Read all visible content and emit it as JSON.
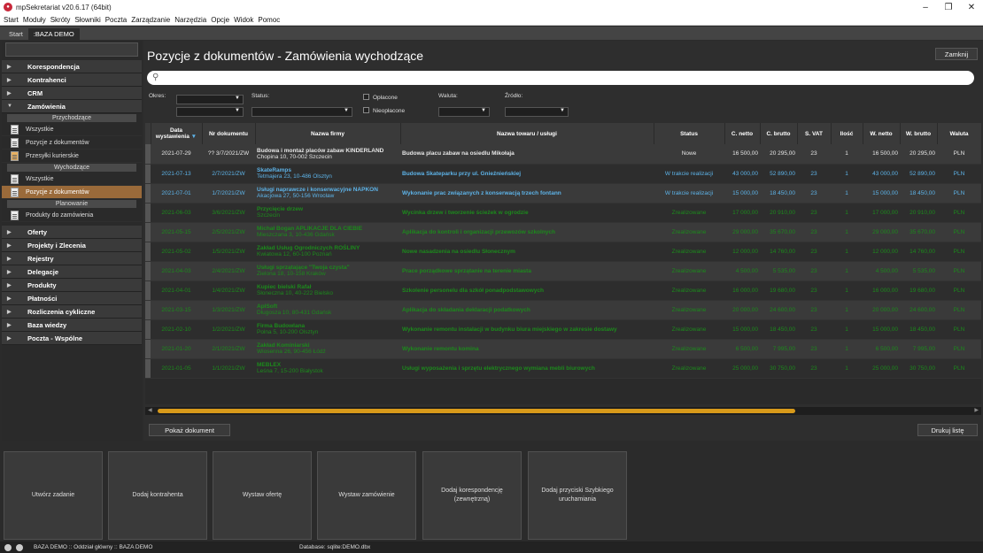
{
  "window": {
    "title": "mpSekretariat v20.6.17 (64bit)",
    "min": "–",
    "max": "❐",
    "close": "✕"
  },
  "menu": [
    "Start",
    "Moduły",
    "Skróty",
    "Słowniki",
    "Poczta",
    "Zarządzanie",
    "Narzędzia",
    "Opcje",
    "Widok",
    "Pomoc"
  ],
  "tabs": [
    {
      "label": "Start"
    },
    {
      "label": ":BAZA DEMO"
    }
  ],
  "sidebar": {
    "groups_top": [
      {
        "label": "Korespondencja"
      },
      {
        "label": "Kontrahenci"
      },
      {
        "label": "CRM"
      },
      {
        "label": "Zamówienia"
      }
    ],
    "sub_incoming": "Przychodzące",
    "incoming_items": [
      "Wszystkie",
      "Pozycje z dokumentów",
      "Przesyłki kurierskie"
    ],
    "sub_outgoing": "Wychodzące",
    "outgoing_items": [
      "Wszystkie",
      "Pozycje z dokumentów"
    ],
    "sub_planning": "Planowanie",
    "planning_items": [
      "Produkty do zamówienia"
    ],
    "groups_bottom": [
      "Oferty",
      "Projekty i Zlecenia",
      "Rejestry",
      "Delegacje",
      "Produkty",
      "Płatności",
      "Rozliczenia cykliczne",
      "Baza wiedzy",
      "Poczta - Wspólne"
    ]
  },
  "main": {
    "title": "Pozycje z dokumentów - Zamówienia wychodzące",
    "close_label": "Zamknij",
    "search_icon": "search-icon",
    "filters": {
      "okres": "Okres:",
      "status": "Status:",
      "paid": "Opłacone",
      "unpaid": "Nieopłacone",
      "currency": "Waluta:",
      "source": "Źródło:"
    },
    "columns": [
      "Data wystawienia",
      "Nr dokumentu",
      "Nazwa firmy",
      "Nazwa towaru / usługi",
      "Status",
      "C. netto",
      "C. brutto",
      "S. VAT",
      "Ilość",
      "W. netto",
      "W. brutto",
      "Waluta"
    ],
    "rows": [
      {
        "date": "2021-07-29",
        "doc": "?? 3/7/2021/ZW",
        "company": "Budowa i montaż placów zabaw KINDERLAND",
        "address": "Chopina 10, 70-002 Szczecin",
        "product": "Budowa placu zabaw na osiedlu Mikołaja",
        "status": "Nowe",
        "cnetto": "16 500,00",
        "cbrutto": "20 295,00",
        "vat": "23",
        "qty": "1",
        "wnetto": "16 500,00",
        "wbrutto": "20 295,00",
        "cur": "PLN",
        "color": "white"
      },
      {
        "date": "2021-07-13",
        "doc": "2/7/2021/ZW",
        "company": "SkateRamps",
        "address": "Tetmajera 23, 10-486 Olsztyn",
        "product": "Budowa Skateparku przy ul. Gnieźnieńskiej",
        "status": "W trakcie realizacji",
        "cnetto": "43 000,00",
        "cbrutto": "52 890,00",
        "vat": "23",
        "qty": "1",
        "wnetto": "43 000,00",
        "wbrutto": "52 890,00",
        "cur": "PLN",
        "color": "blue"
      },
      {
        "date": "2021-07-01",
        "doc": "1/7/2021/ZW",
        "company": "Usługi naprawcze i konserwacyjne NAPKON",
        "address": "Akacjowa 27, 50-156 Wrocław",
        "product": "Wykonanie prac związanych z konserwacją trzech fontann",
        "status": "W trakcie realizacji",
        "cnetto": "15 000,00",
        "cbrutto": "18 450,00",
        "vat": "23",
        "qty": "1",
        "wnetto": "15 000,00",
        "wbrutto": "18 450,00",
        "cur": "PLN",
        "color": "blue"
      },
      {
        "date": "2021-06-03",
        "doc": "3/6/2021/ZW",
        "company": "Przycięcie drzew",
        "address": "Szczecin",
        "product": "Wycinka drzew i tworzenie ścieżek w ogrodzie",
        "status": "Zrealizowane",
        "cnetto": "17 000,00",
        "cbrutto": "20 910,00",
        "vat": "23",
        "qty": "1",
        "wnetto": "17 000,00",
        "wbrutto": "20 910,00",
        "cur": "PLN",
        "color": "green"
      },
      {
        "date": "2021-05-15",
        "doc": "2/5/2021/ZW",
        "company": "Michał Bogan APLIKACJE DLA CIEBIE",
        "address": "Mieszczana 3, 10-436 Gdańsk",
        "product": "Aplikacja do kontroli i organizacji przewozów szkolnych",
        "status": "Zrealizowane",
        "cnetto": "29 000,00",
        "cbrutto": "35 670,00",
        "vat": "23",
        "qty": "1",
        "wnetto": "29 000,00",
        "wbrutto": "35 670,00",
        "cur": "PLN",
        "color": "green"
      },
      {
        "date": "2021-05-02",
        "doc": "1/5/2021/ZW",
        "company": "Zakład Usług Ogrodniczych ROŚLINY",
        "address": "Kwiatowa 12, 60-100 Poznań",
        "product": "Nowe nasadzenia na osiedlu Słonecznym",
        "status": "Zrealizowane",
        "cnetto": "12 000,00",
        "cbrutto": "14 760,00",
        "vat": "23",
        "qty": "1",
        "wnetto": "12 000,00",
        "wbrutto": "14 760,00",
        "cur": "PLN",
        "color": "green"
      },
      {
        "date": "2021-04-03",
        "doc": "2/4/2021/ZW",
        "company": "Usługi sprzątające \"Twoja czysta\"",
        "address": "Zielona 18, 10-158 Kraków",
        "product": "Prace porządkowe sprzątanie na terenie miasta",
        "status": "Zrealizowane",
        "cnetto": "4 500,00",
        "cbrutto": "5 535,00",
        "vat": "23",
        "qty": "1",
        "wnetto": "4 500,00",
        "wbrutto": "5 535,00",
        "cur": "PLN",
        "color": "green"
      },
      {
        "date": "2021-04-01",
        "doc": "1/4/2021/ZW",
        "company": "Kupiec bielski Rafał",
        "address": "Słoneczna 10, 40-222 Bielsko",
        "product": "Szkolenie personelu dla szkół ponadpodstawowych",
        "status": "Zrealizowane",
        "cnetto": "16 000,00",
        "cbrutto": "19 680,00",
        "vat": "23",
        "qty": "1",
        "wnetto": "16 000,00",
        "wbrutto": "19 680,00",
        "cur": "PLN",
        "color": "green"
      },
      {
        "date": "2021-03-15",
        "doc": "1/3/2021/ZW",
        "company": "AplSoft",
        "address": "Długosza 10, 80-431 Gdańsk",
        "product": "Aplikacja do składania deklaracji podatkowych",
        "status": "Zrealizowane",
        "cnetto": "20 000,00",
        "cbrutto": "24 600,00",
        "vat": "23",
        "qty": "1",
        "wnetto": "20 000,00",
        "wbrutto": "24 600,00",
        "cur": "PLN",
        "color": "green"
      },
      {
        "date": "2021-02-10",
        "doc": "1/2/2021/ZW",
        "company": "Firma Budowlana",
        "address": "Polna 5, 10-200 Olsztyn",
        "product": "Wykonanie remontu instalacji w budynku biura miejskiego w zakresie dostawy",
        "status": "Zrealizowane",
        "cnetto": "15 000,00",
        "cbrutto": "18 450,00",
        "vat": "23",
        "qty": "1",
        "wnetto": "15 000,00",
        "wbrutto": "18 450,00",
        "cur": "PLN",
        "color": "green"
      },
      {
        "date": "2021-01-20",
        "doc": "2/1/2021/ZW",
        "company": "Zakład Kominiarski",
        "address": "Wiosenna 26, 90-456 Łódź",
        "product": "Wykonanie remontu komina",
        "status": "Zrealizowane",
        "cnetto": "6 500,00",
        "cbrutto": "7 995,00",
        "vat": "23",
        "qty": "1",
        "wnetto": "6 500,00",
        "wbrutto": "7 995,00",
        "cur": "PLN",
        "color": "green"
      },
      {
        "date": "2021-01-05",
        "doc": "1/1/2021/ZW",
        "company": "MEBLEX",
        "address": "Leśna 7, 15-200 Białystok",
        "product": "Usługi wyposażenia i sprzętu elektrycznego wymiana mebli biurowych",
        "status": "Zrealizowane",
        "cnetto": "25 000,00",
        "cbrutto": "30 750,00",
        "vat": "23",
        "qty": "1",
        "wnetto": "25 000,00",
        "wbrutto": "30 750,00",
        "cur": "PLN",
        "color": "green"
      }
    ],
    "show_doc": "Pokaż dokument",
    "print_list": "Drukuj listę"
  },
  "quick_actions": [
    "Utwórz zadanie",
    "Dodaj kontrahenta",
    "Wystaw ofertę",
    "Wystaw zamówienie",
    "Dodaj korespondencję (zewnętrzną)",
    "Dodaj przyciski Szybkiego uruchamiania"
  ],
  "status_bar": {
    "left": "BAZA DEMO :: Oddział główny :: BAZA DEMO",
    "db": "Database: sqlite:DEMO.dbx"
  }
}
